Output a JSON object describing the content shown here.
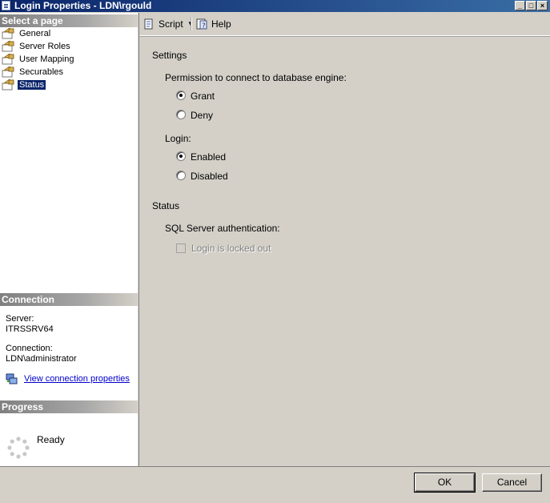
{
  "window": {
    "title": "Login Properties - LDN\\rgould",
    "min_glyph": "_",
    "max_glyph": "□",
    "close_glyph": "×"
  },
  "left": {
    "select_page_header": "Select a page",
    "pages": [
      {
        "label": "General",
        "icon": "page-settings-icon"
      },
      {
        "label": "Server Roles",
        "icon": "page-settings-icon"
      },
      {
        "label": "User Mapping",
        "icon": "page-settings-icon"
      },
      {
        "label": "Securables",
        "icon": "page-settings-icon"
      },
      {
        "label": "Status",
        "icon": "page-settings-icon",
        "selected": true
      }
    ],
    "connection_header": "Connection",
    "server_label": "Server:",
    "server_value": "ITRSSRV64",
    "connection_label": "Connection:",
    "connection_value": "LDN\\administrator",
    "view_link": "View connection properties",
    "progress_header": "Progress",
    "progress_status": "Ready"
  },
  "toolbar": {
    "script_label": "Script",
    "help_label": "Help"
  },
  "settings": {
    "settings_header": "Settings",
    "permission_label": "Permission to connect to database engine:",
    "grant_label": "Grant",
    "deny_label": "Deny",
    "permission_selected": "Grant",
    "login_label": "Login:",
    "enabled_label": "Enabled",
    "disabled_label": "Disabled",
    "login_selected": "Enabled",
    "status_header": "Status",
    "sql_auth_label": "SQL Server authentication:",
    "locked_out_label": "Login is locked out",
    "locked_out_checked": false
  },
  "buttons": {
    "ok": "OK",
    "cancel": "Cancel"
  },
  "colors": {
    "title_bar": "#0a246a",
    "selection": "#0a246a",
    "link": "#0000cc",
    "dialog_bg": "#d4d0c8"
  }
}
